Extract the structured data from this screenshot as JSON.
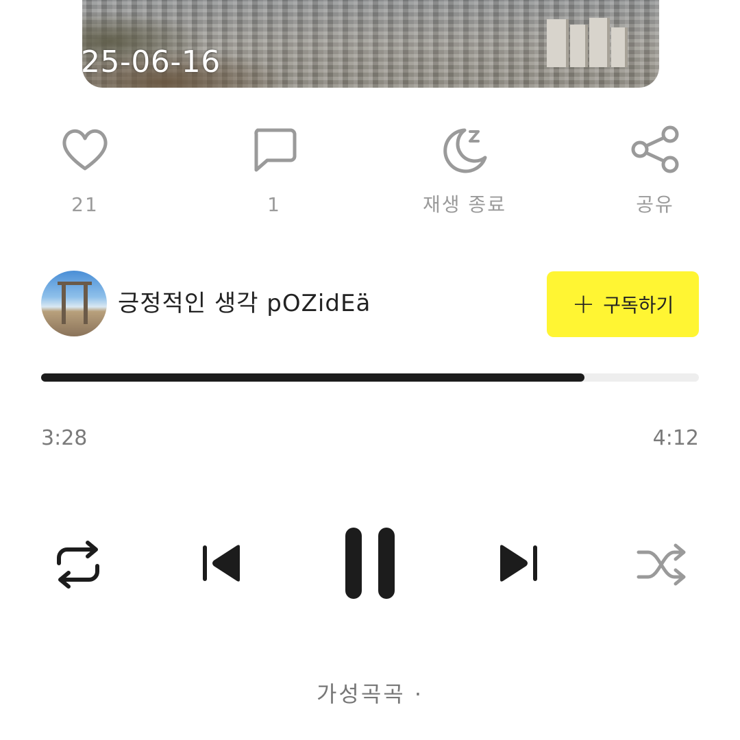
{
  "cover": {
    "date": "25-06-16"
  },
  "actions": {
    "like_count": "21",
    "comment_count": "1",
    "sleep_timer_label": "재생 종료",
    "share_label": "공유"
  },
  "channel": {
    "name": "긍정적인 생각 pOZidEä",
    "subscribe_label": "구독하기"
  },
  "player": {
    "progress_fraction": 0.826,
    "elapsed": "3:28",
    "duration": "4:12"
  },
  "footer": {
    "text": "가성곡곡 ·"
  },
  "icons": {
    "like": "heart-icon",
    "comment": "comment-icon",
    "sleep": "sleep-timer-icon",
    "share": "share-icon",
    "repeat": "repeat-icon",
    "previous": "skip-previous-icon",
    "pause": "pause-icon",
    "next": "skip-next-icon",
    "shuffle": "shuffle-icon"
  },
  "colors": {
    "subscribe_bg": "#fff533",
    "progress_fill": "#1c1c1c",
    "muted": "#9a9a9a"
  }
}
